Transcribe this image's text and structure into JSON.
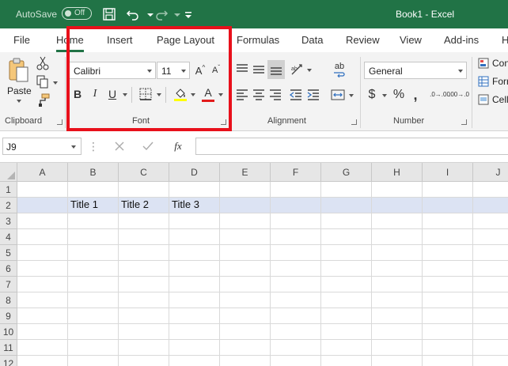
{
  "titlebar": {
    "autosave_label": "AutoSave",
    "autosave_state": "Off",
    "doc_title": "Book1  -  Excel",
    "accent": "#217346"
  },
  "tabs": [
    {
      "label": "File"
    },
    {
      "label": "Home",
      "active": true
    },
    {
      "label": "Insert"
    },
    {
      "label": "Page Layout"
    },
    {
      "label": "Formulas"
    },
    {
      "label": "Data"
    },
    {
      "label": "Review"
    },
    {
      "label": "View"
    },
    {
      "label": "Add-ins"
    },
    {
      "label": "H"
    }
  ],
  "ribbon": {
    "clipboard": {
      "paste_label": "Paste",
      "group_label": "Clipboard"
    },
    "font": {
      "font_name": "Calibri",
      "font_size": "11",
      "bold": "B",
      "italic": "I",
      "underline": "U",
      "grow": "A",
      "shrink": "A",
      "font_color": "A",
      "group_label": "Font"
    },
    "alignment": {
      "group_label": "Alignment",
      "wrap_label": "ab"
    },
    "number": {
      "format": "General",
      "currency": "$",
      "percent": "%",
      "comma": ",",
      "inc_decimal": ".0→.00",
      "dec_decimal": ".00→.0",
      "group_label": "Number"
    },
    "styles": {
      "items": [
        "Con",
        "Forr",
        "Cell"
      ]
    }
  },
  "formula_bar": {
    "cell_ref": "J9",
    "fx": "fx",
    "value": ""
  },
  "grid": {
    "columns": [
      "A",
      "B",
      "C",
      "D",
      "E",
      "F",
      "G",
      "H",
      "I",
      "J"
    ],
    "rows": [
      "1",
      "2",
      "3",
      "4",
      "5",
      "6",
      "7",
      "8",
      "9",
      "10",
      "11",
      "12"
    ],
    "cells": {
      "B2": "Title 1",
      "C2": "Title 2",
      "D2": "Title 3"
    },
    "highlight_row": "2",
    "highlight_color": "#dce3f3"
  },
  "annotation": {
    "color": "#e8101b"
  }
}
